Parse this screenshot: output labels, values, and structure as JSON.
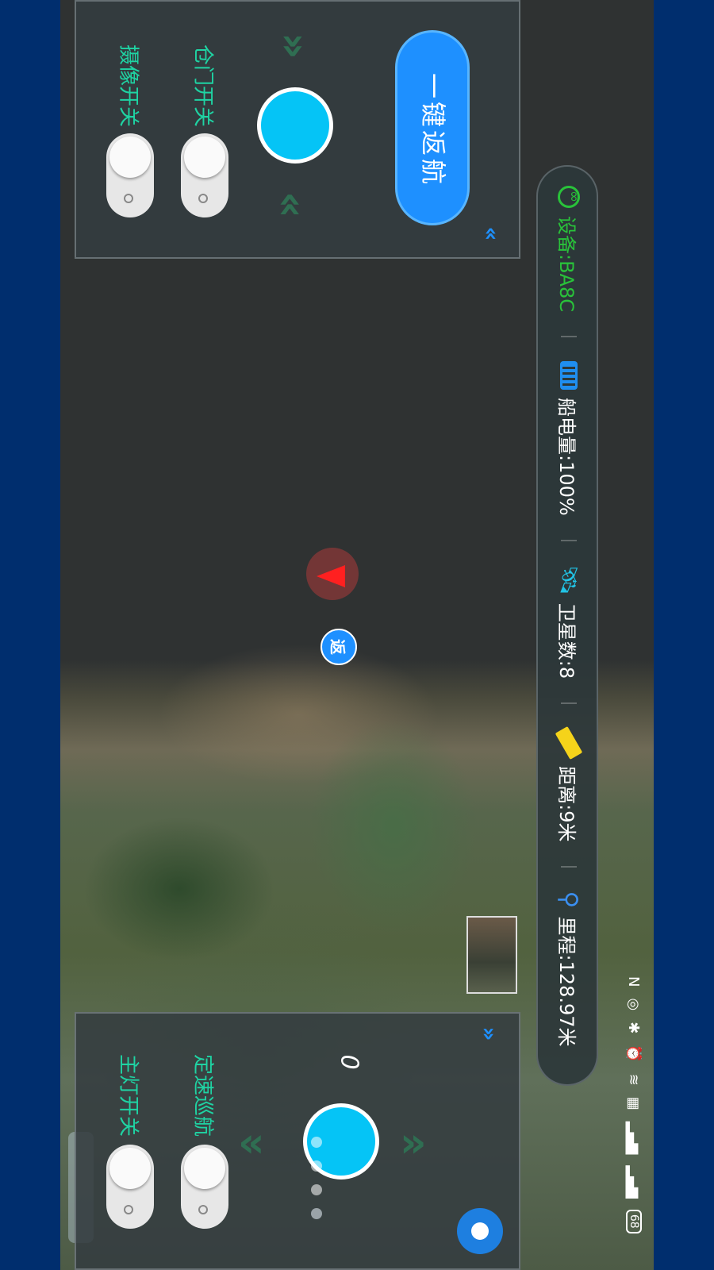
{
  "status_bar": {
    "nfc": "N",
    "battery": "68"
  },
  "info_bar": {
    "device": "设备:BA8C",
    "battery": "船电量:100%",
    "satellites": "卫星数:8",
    "distance": "距离:9米",
    "mileage": "里程:128.97米"
  },
  "top_panel": {
    "return_button": "一键返航",
    "hatch_label": "仓门开关",
    "camera_label": "摄像开关"
  },
  "bottom_panel": {
    "speed_value": "0",
    "cruise_label": "定速巡航",
    "light_label": "主灯开关"
  },
  "map": {
    "home_marker": "返"
  },
  "colors": {
    "accent_blue": "#1e90ff",
    "knob_cyan": "#05c4f6",
    "label_green": "#1fd3a3",
    "device_green": "#29c23a",
    "arrow_green": "#2f6e52"
  },
  "icons": [
    "link-icon",
    "battery-icon",
    "satellite-icon",
    "ruler-icon",
    "route-icon",
    "gear-icon",
    "chevron-double-icon"
  ]
}
